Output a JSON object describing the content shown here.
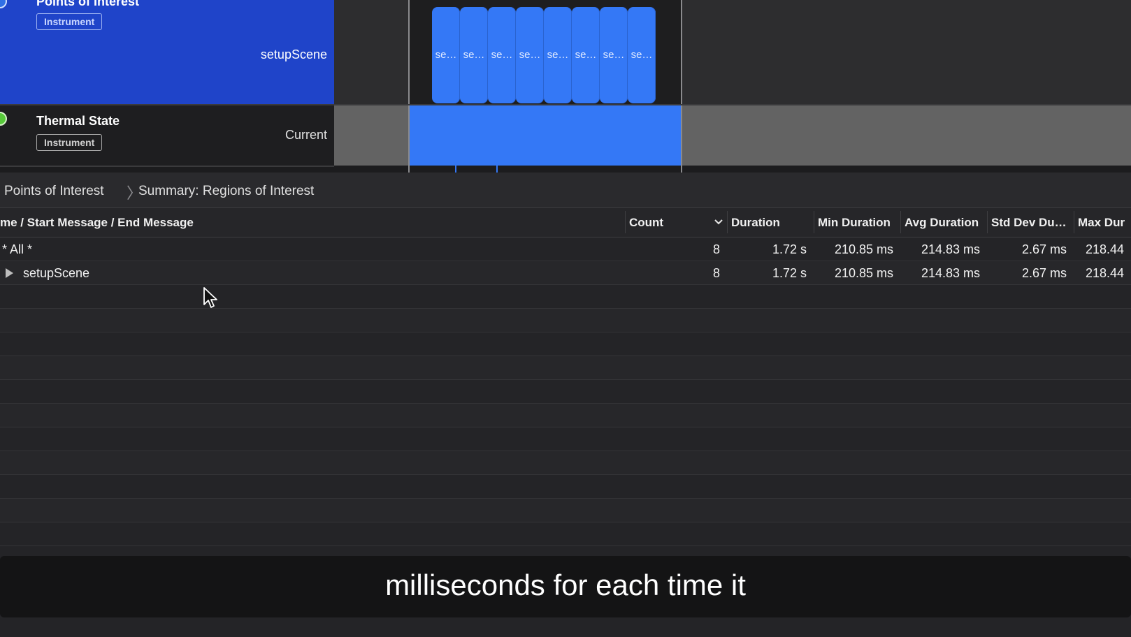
{
  "timeline": {
    "tracks": [
      {
        "title": "Points of Interest",
        "badge": "Instrument",
        "lane_label": "setupScene"
      },
      {
        "title": "Thermal State",
        "badge": "Instrument",
        "lane_label": "Current"
      }
    ],
    "regions": [
      "se…",
      "se…",
      "se…",
      "se…",
      "se…",
      "se…",
      "se…",
      "se…"
    ],
    "colors": {
      "accent": "#3478f6",
      "track_header_selected": "#1f44c9",
      "thermal_indicator": "#57c93a"
    }
  },
  "breadcrumb": {
    "items": [
      "Points of Interest",
      "Summary: Regions of Interest"
    ],
    "separator": "〉"
  },
  "table": {
    "columns": {
      "name": "me / Start Message / End Message",
      "count": "Count",
      "duration": "Duration",
      "min": "Min Duration",
      "avg": "Avg Duration",
      "std": "Std Dev Du…",
      "max": "Max Dur"
    },
    "sort_icon": "chevron-down-icon",
    "rows": [
      {
        "name": "* All *",
        "count": "8",
        "duration": "1.72 s",
        "min": "210.85 ms",
        "avg": "214.83 ms",
        "std": "2.67 ms",
        "max": "218.44"
      },
      {
        "name": "setupScene",
        "count": "8",
        "duration": "1.72 s",
        "min": "210.85 ms",
        "avg": "214.83 ms",
        "std": "2.67 ms",
        "max": "218.44"
      }
    ]
  },
  "caption": "milliseconds for each time it"
}
